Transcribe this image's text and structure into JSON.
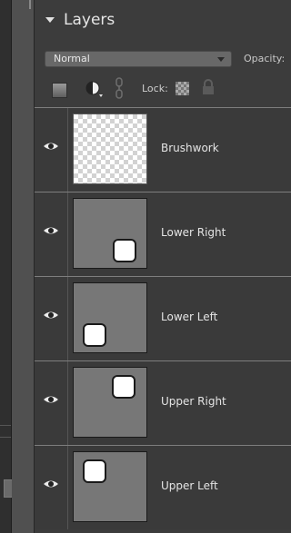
{
  "panel": {
    "title": "Layers",
    "collapse_icon": "triangle-down-icon"
  },
  "controls": {
    "blend_mode": "Normal",
    "opacity_label": "Opacity:",
    "lock_label": "Lock:"
  },
  "toolbar_icons": [
    "new-layer-icon",
    "adjustment-layer-icon",
    "link-icon",
    "lock-transparency-icon",
    "lock-all-icon"
  ],
  "layers": [
    {
      "name": "Brushwork",
      "visible": true,
      "thumbnail": "transparent"
    },
    {
      "name": "Lower Right",
      "visible": true,
      "thumbnail": "square-lower-right"
    },
    {
      "name": "Lower Left",
      "visible": true,
      "thumbnail": "square-lower-left"
    },
    {
      "name": "Upper Right",
      "visible": true,
      "thumbnail": "square-upper-right"
    },
    {
      "name": "Upper Left",
      "visible": true,
      "thumbnail": "square-upper-left"
    }
  ]
}
